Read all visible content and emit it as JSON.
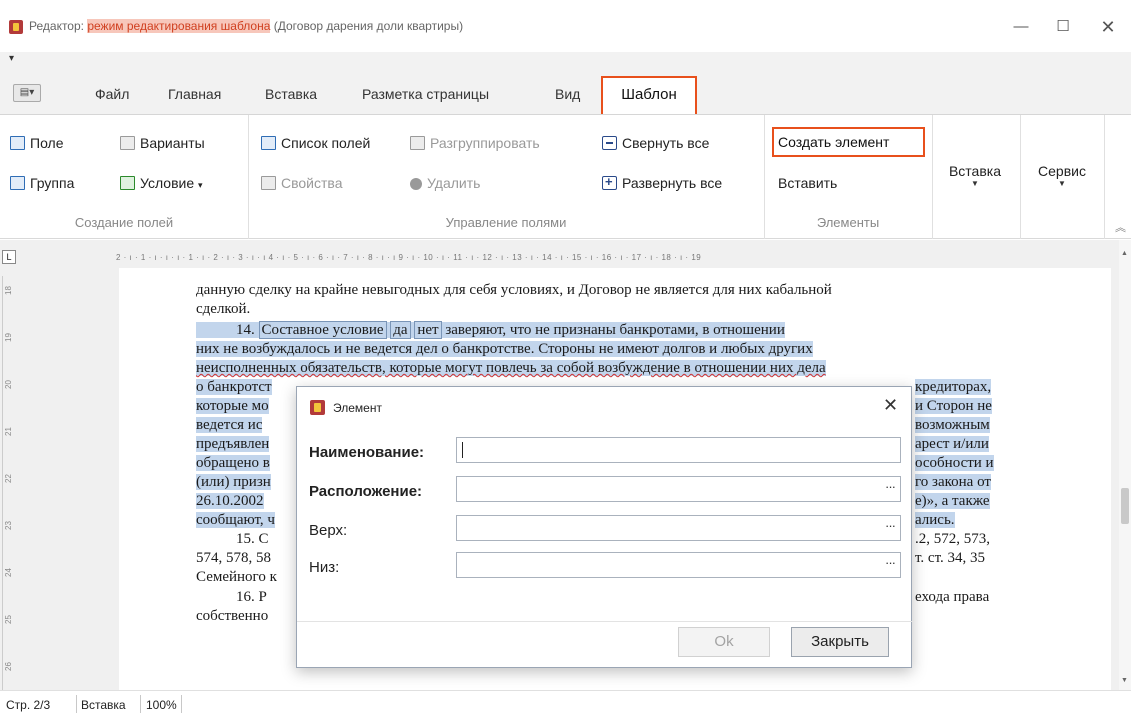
{
  "window": {
    "title_prefix": "Редактор:",
    "title_mode": "режим редактирования шаблона",
    "title_doc": "(Договор дарения доли квартиры)",
    "minimize": "—",
    "maximize": "☐",
    "close": "✕"
  },
  "qat": {
    "dropdown_arrow": "▾"
  },
  "tabs": {
    "file": "Файл",
    "home": "Главная",
    "insert": "Вставка",
    "layout": "Разметка страницы",
    "view": "Вид",
    "template": "Шаблон"
  },
  "ribbon": {
    "field": "Поле",
    "variants": "Варианты",
    "group": "Группа",
    "condition": "Условие",
    "field_list": "Список полей",
    "ungroup": "Разгруппировать",
    "properties": "Свойства",
    "delete": "Удалить",
    "collapse_all": "Свернуть все",
    "expand_all": "Развернуть все",
    "create_element": "Создать элемент",
    "paste": "Вставить",
    "insert_big": "Вставка",
    "service": "Сервис",
    "group_create_fields": "Создание полей",
    "group_manage_fields": "Управление полями",
    "group_elements": "Элементы"
  },
  "ruler": {
    "ticks": "2 · ı · 1 · ı · ı · ı · 1 · ı · 2 · ı · 3 · ı · ı 4 · ı · 5 · ı · 6 · ı · 7 · ı · 8 · ı · ı 9 · ı · 10 · ı · 11 · ı · 12 · ı · 13 · ı · 14 · ı · 15 · ı · 16 · ı · 17 · ı · 18 · ı · 19",
    "vticks": [
      "18",
      "19",
      "20",
      "21",
      "22",
      "23",
      "24",
      "25",
      "26"
    ]
  },
  "document": {
    "line1": "данную сделку на крайне невыгодных для себя условиях, и Договор не является для них кабальной",
    "line2": "сделкой.",
    "line3_num": "14.",
    "line3_field": "Составное условие",
    "line3_yes": "да",
    "line3_no": "нет",
    "line3_rest": "заверяют, что не признаны банкротами, в отношении",
    "line4": "них не возбуждалось и не ведется дел о банкротстве. Стороны не имеют долгов и любых других",
    "line5": "неисполненных обязательств, которые могут повлечь за собой возбуждение в отношении них дела",
    "line6_left": "о банкротст",
    "line6_right": "кредиторах,",
    "line7_left": "которые мо",
    "line7_right": "и Сторон не",
    "line8_left": "ведется ис",
    "line8_right": "возможным",
    "line9_left": "предъявлен",
    "line9_right": "арест и/или",
    "line10_left": "обращено в",
    "line10_right": "особности и",
    "line11_left": "(или) призн",
    "line11_right": "го закона от",
    "line12_left": "26.10.2002",
    "line12_right": "е)», а также",
    "line13_left": "сообщают, ч",
    "line13_right": "ались.",
    "line14_left": "15. С",
    "line14_right": ".2, 572, 573,",
    "line15_left": "574, 578, 58",
    "line15_right": "т. ст. 34, 35",
    "line16_left": "Семейного к",
    "line17_left": "16. Р",
    "line17_right": "ехода права",
    "line18_left": "собственно"
  },
  "dialog": {
    "title": "Элемент",
    "close": "✕",
    "name_label": "Наименование:",
    "location_label": "Расположение:",
    "top_label": "Верх:",
    "bottom_label": "Низ:",
    "ellipsis": "···",
    "ok": "Ok",
    "close_button": "Закрыть"
  },
  "status": {
    "page": "Стр. 2/3",
    "mode": "Вставка",
    "zoom": "100%"
  },
  "colors": {
    "accent_highlight": "#e8501c",
    "selection": "#c2d5ec",
    "title_highlight": "#f7c7bb"
  }
}
